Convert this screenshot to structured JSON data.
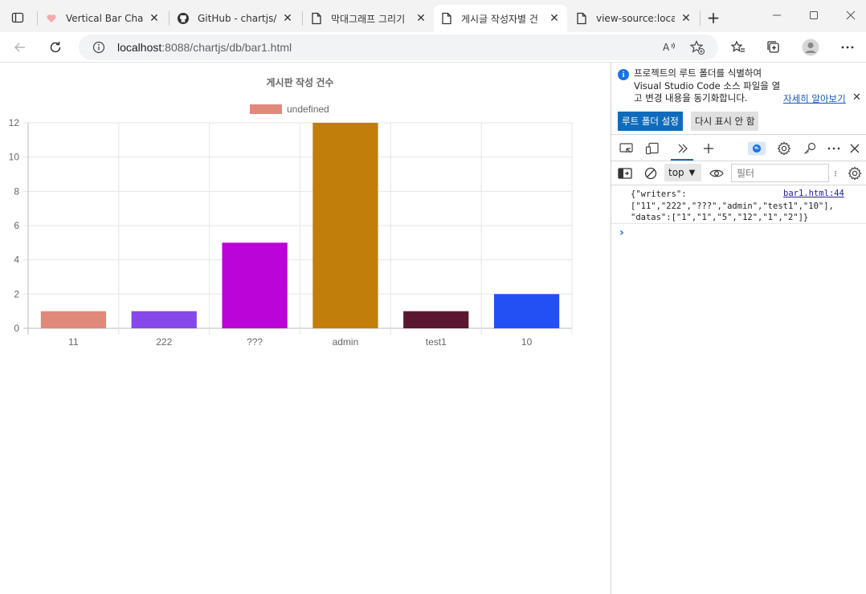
{
  "browser": {
    "tabs": [
      {
        "title": "Vertical Bar Chart |",
        "icon": "chartjs-logo-icon"
      },
      {
        "title": "GitHub - chartjs/C",
        "icon": "github-icon"
      },
      {
        "title": "막대그래프 그리기",
        "icon": "page-icon"
      },
      {
        "title": "게시글 작성자별 건",
        "icon": "page-icon"
      },
      {
        "title": "view-source:localh",
        "icon": "page-icon"
      }
    ],
    "active_tab_index": 3,
    "url_host": "localhost",
    "url_rest": ":8088/chartjs/db/bar1.html"
  },
  "devtools": {
    "notice_text": "프로젝트의 루트 폴더를 식별하여 Visual Studio Code 소스 파일을 열고 변경 내용을 동기화합니다.",
    "learn_more": "자세히 알아보기",
    "set_root_button": "루트 폴더 설정",
    "dont_show_button": "다시 표시 안 함",
    "context": "top",
    "filter_placeholder": "필터",
    "log_text": "{\"writers\":\n[\"11\",\"222\",\"???\",\"admin\",\"test1\",\"10\"],\n\"datas\":[\"1\",\"1\",\"5\",\"12\",\"1\",\"2\"]}",
    "log_source": "bar1.html:44"
  },
  "chart_data": {
    "type": "bar",
    "title": "게시판 작성 건수",
    "legend_label": "undefined",
    "legend_position": "top",
    "categories": [
      "11",
      "222",
      "???",
      "admin",
      "test1",
      "10"
    ],
    "values": [
      1,
      1,
      5,
      12,
      1,
      2
    ],
    "colors": [
      "#e0897a",
      "#8648e8",
      "#bb04d8",
      "#c27e0b",
      "#5a1830",
      "#2350f5"
    ],
    "legend_color": "#e0897a",
    "ylim": [
      0,
      12
    ],
    "yticks": [
      0,
      2,
      4,
      6,
      8,
      10,
      12
    ],
    "grid": true
  }
}
